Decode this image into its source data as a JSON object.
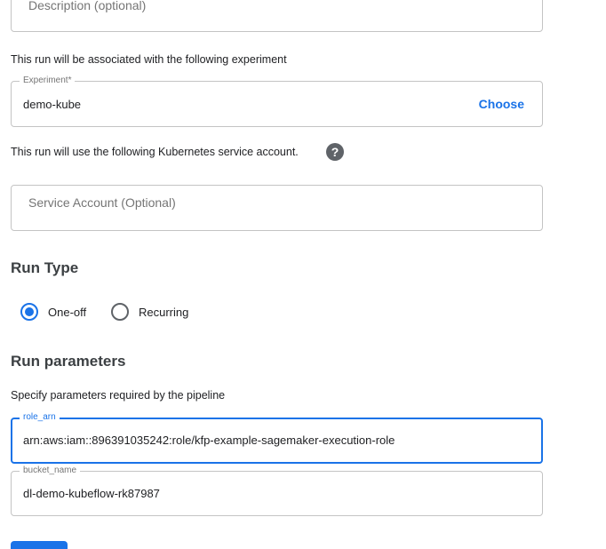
{
  "description": {
    "placeholder": "Description (optional)"
  },
  "experiment": {
    "intro_text": "This run will be associated with the following experiment",
    "label": "Experiment*",
    "value": "demo-kube",
    "choose_label": "Choose"
  },
  "service_account": {
    "intro_text": "This run will use the following Kubernetes service account.",
    "help_icon": "question-mark-icon",
    "help_glyph": "?",
    "placeholder": "Service Account (Optional)"
  },
  "run_type": {
    "heading": "Run Type",
    "options": [
      {
        "label": "One-off",
        "selected": true
      },
      {
        "label": "Recurring",
        "selected": false
      }
    ]
  },
  "run_parameters": {
    "heading": "Run parameters",
    "intro_text": "Specify parameters required by the pipeline",
    "params": [
      {
        "name": "role_arn",
        "value": "arn:aws:iam::896391035242:role/kfp-example-sagemaker-execution-role",
        "focused": true
      },
      {
        "name": "bucket_name",
        "value": "dl-demo-kubeflow-rk87987",
        "focused": false
      }
    ]
  },
  "colors": {
    "accent": "#1a73e8",
    "border": "#c4c4c4",
    "muted_text": "#757575"
  }
}
